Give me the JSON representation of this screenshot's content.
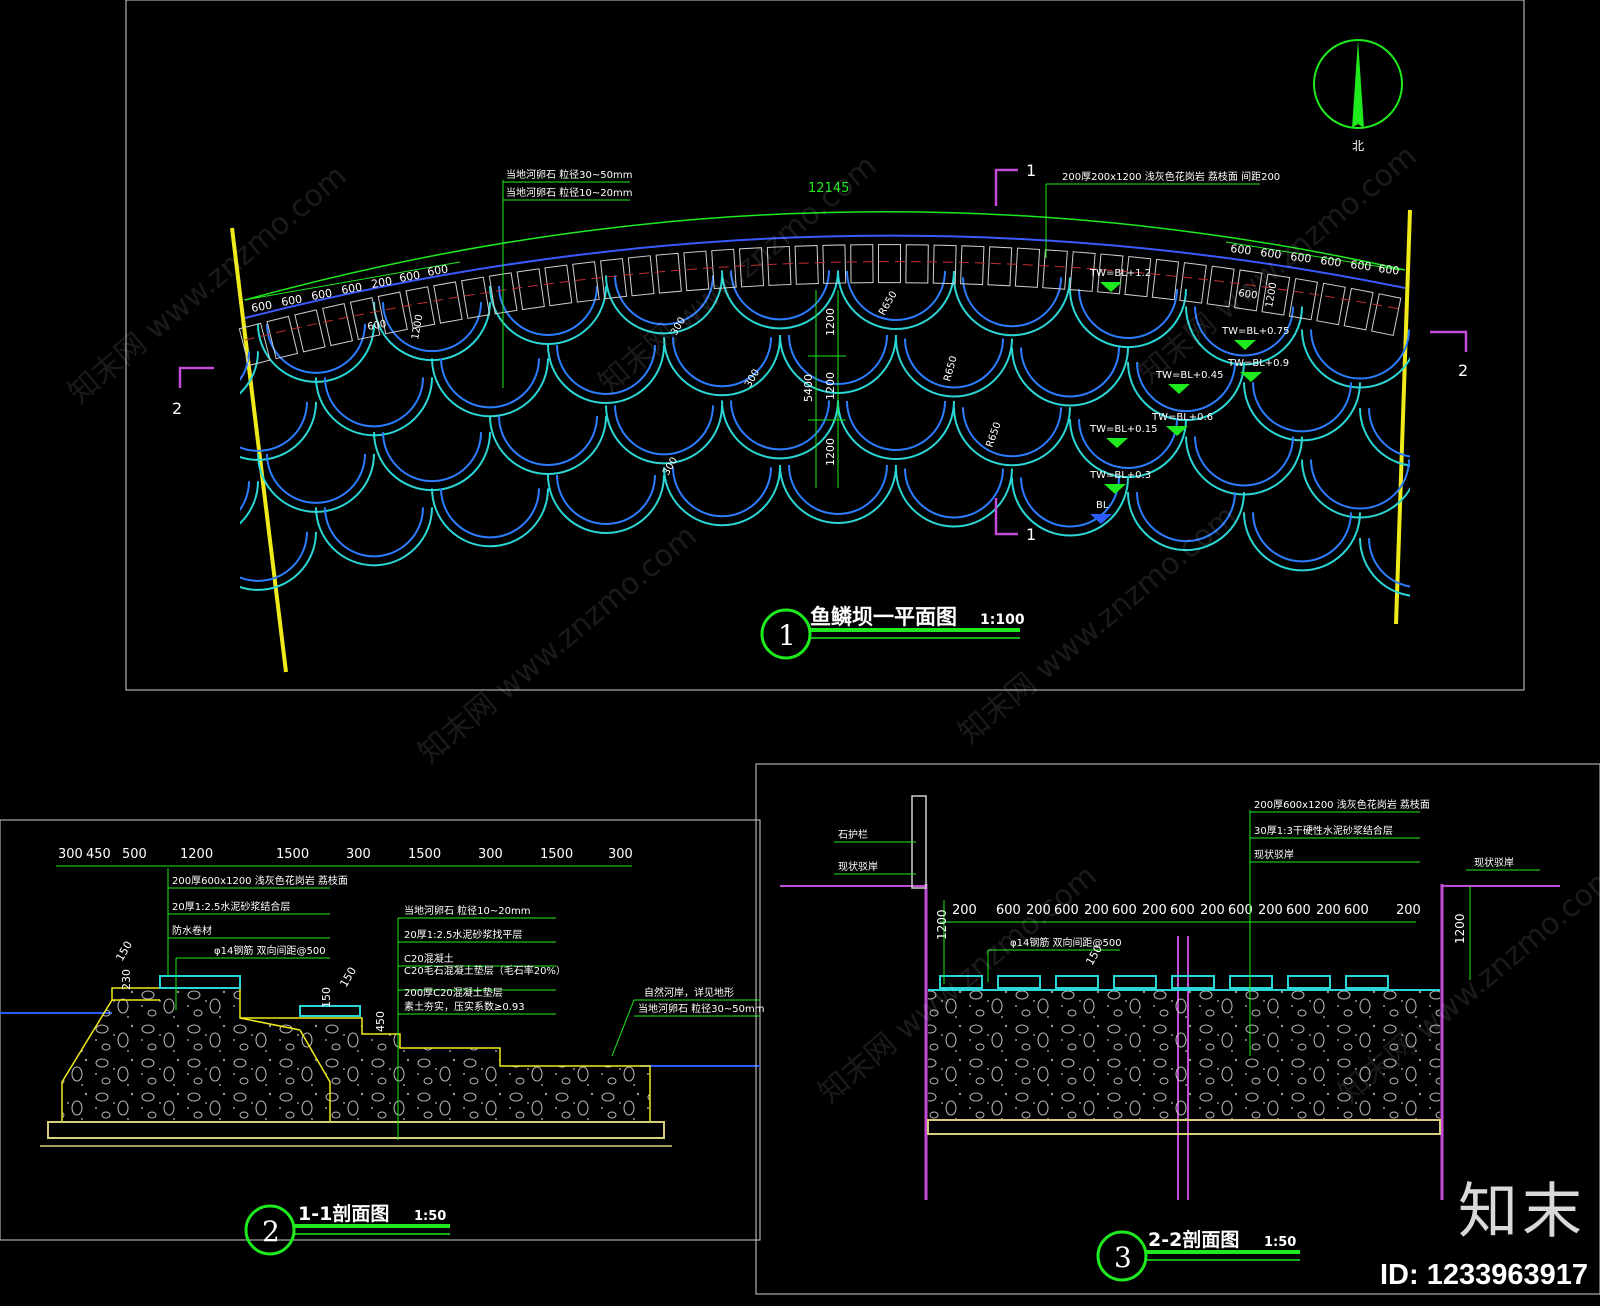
{
  "colors": {
    "frame": "#cfcfcf",
    "green": "#1eea1e",
    "yellow": "#f0ea1a",
    "cyan": "#2bd6d6",
    "blue": "#2c5cff",
    "magenta": "#c24bd8",
    "tan": "#d7cf7a",
    "white": "#ffffff"
  },
  "plan": {
    "title_num": "1",
    "title": "鱼鳞坝一平面图",
    "scale": "1:100",
    "arc_length": "12145",
    "north_label": "北",
    "leader_top_1": "当地河卵石 粒径30~50mm",
    "leader_top_2": "当地河卵石 粒径10~20mm",
    "leader_right": "200厚200x1200 浅灰色花岗岩 荔枝面 间距200",
    "dims_left": [
      "600",
      "600",
      "600",
      "600",
      "200",
      "600",
      "600"
    ],
    "dims_right": [
      "600",
      "600",
      "600",
      "600",
      "600",
      "600"
    ],
    "dim_small_1": "600",
    "dim_small_2": "1200",
    "dim_small_3": "600",
    "dim_small_4": "1200",
    "radius_labels": [
      "300",
      "300",
      "300",
      "R650",
      "R650",
      "R650"
    ],
    "vertical_dims": [
      "1200",
      "5400",
      "1200",
      "1200"
    ],
    "elev_labels": [
      "TW=BL+1.2",
      "TW=BL+0.75",
      "TW=BL+0.9",
      "TW=BL+0.45",
      "TW=BL+0.6",
      "TW=BL+0.15",
      "TW=BL+0.3"
    ],
    "bl_label": "BL",
    "section_marks": {
      "s1_top": "1",
      "s1_bottom": "1",
      "s2_left": "2",
      "s2_right": "2"
    }
  },
  "section1": {
    "title_num": "2",
    "title": "1-1剖面图",
    "scale": "1:50",
    "dims": [
      "300",
      "450",
      "500",
      "1200",
      "1500",
      "300",
      "1500",
      "300",
      "1500",
      "300"
    ],
    "notes_left": [
      "200厚600x1200 浅灰色花岗岩 荔枝面",
      "20厚1:2.5水泥砂浆结合层",
      "防水卷材"
    ],
    "note_mid": "φ14钢筋 双向间距@500",
    "notes_right": [
      "当地河卵石 粒径10~20mm",
      "20厚1:2.5水泥砂浆找平层",
      "C20混凝土",
      "C20毛石混凝土垫层（毛石率20%）",
      "200厚C20混凝土垫层",
      "素土夯实，压实系数≥0.93"
    ],
    "note_far": "自然河岸，详见地形",
    "note_far2": "当地河卵石 粒径30~50mm",
    "small_dims": [
      "230",
      "150",
      "150",
      "450",
      "150",
      "50"
    ]
  },
  "section2": {
    "title_num": "3",
    "title": "2-2剖面图",
    "scale": "1:50",
    "dims": [
      "200",
      "600",
      "200",
      "600",
      "200",
      "600",
      "200",
      "600",
      "200",
      "600",
      "200",
      "600",
      "200",
      "600",
      "200"
    ],
    "note_left_1": "石护栏",
    "note_left_2": "现状驳岸",
    "note_right": "现状驳岸",
    "notes_top": [
      "200厚600x1200 浅灰色花岗岩 荔枝面",
      "30厚1:3干硬性水泥砂浆结合层",
      "现状驳岸"
    ],
    "note_mid": "φ14钢筋 双向间距@500",
    "small_dim": "150",
    "height_left": "1200",
    "height_right": "1200"
  },
  "watermark": {
    "brand": "知末",
    "id": "ID: 1233963917",
    "site": "www.znzmo.com",
    "cn": "知末网"
  }
}
